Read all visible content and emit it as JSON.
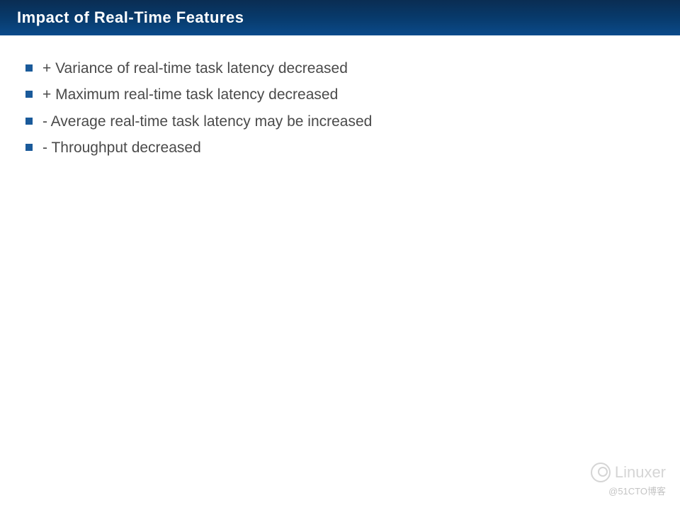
{
  "title": "Impact of Real-Time Features",
  "bullets": [
    "+ Variance of real-time task latency decreased",
    "+ Maximum real-time task latency decreased",
    "-  Average real-time task latency may be increased",
    "-  Throughput decreased"
  ],
  "watermark": {
    "name": "Linuxer",
    "sub": "@51CTO博客"
  }
}
